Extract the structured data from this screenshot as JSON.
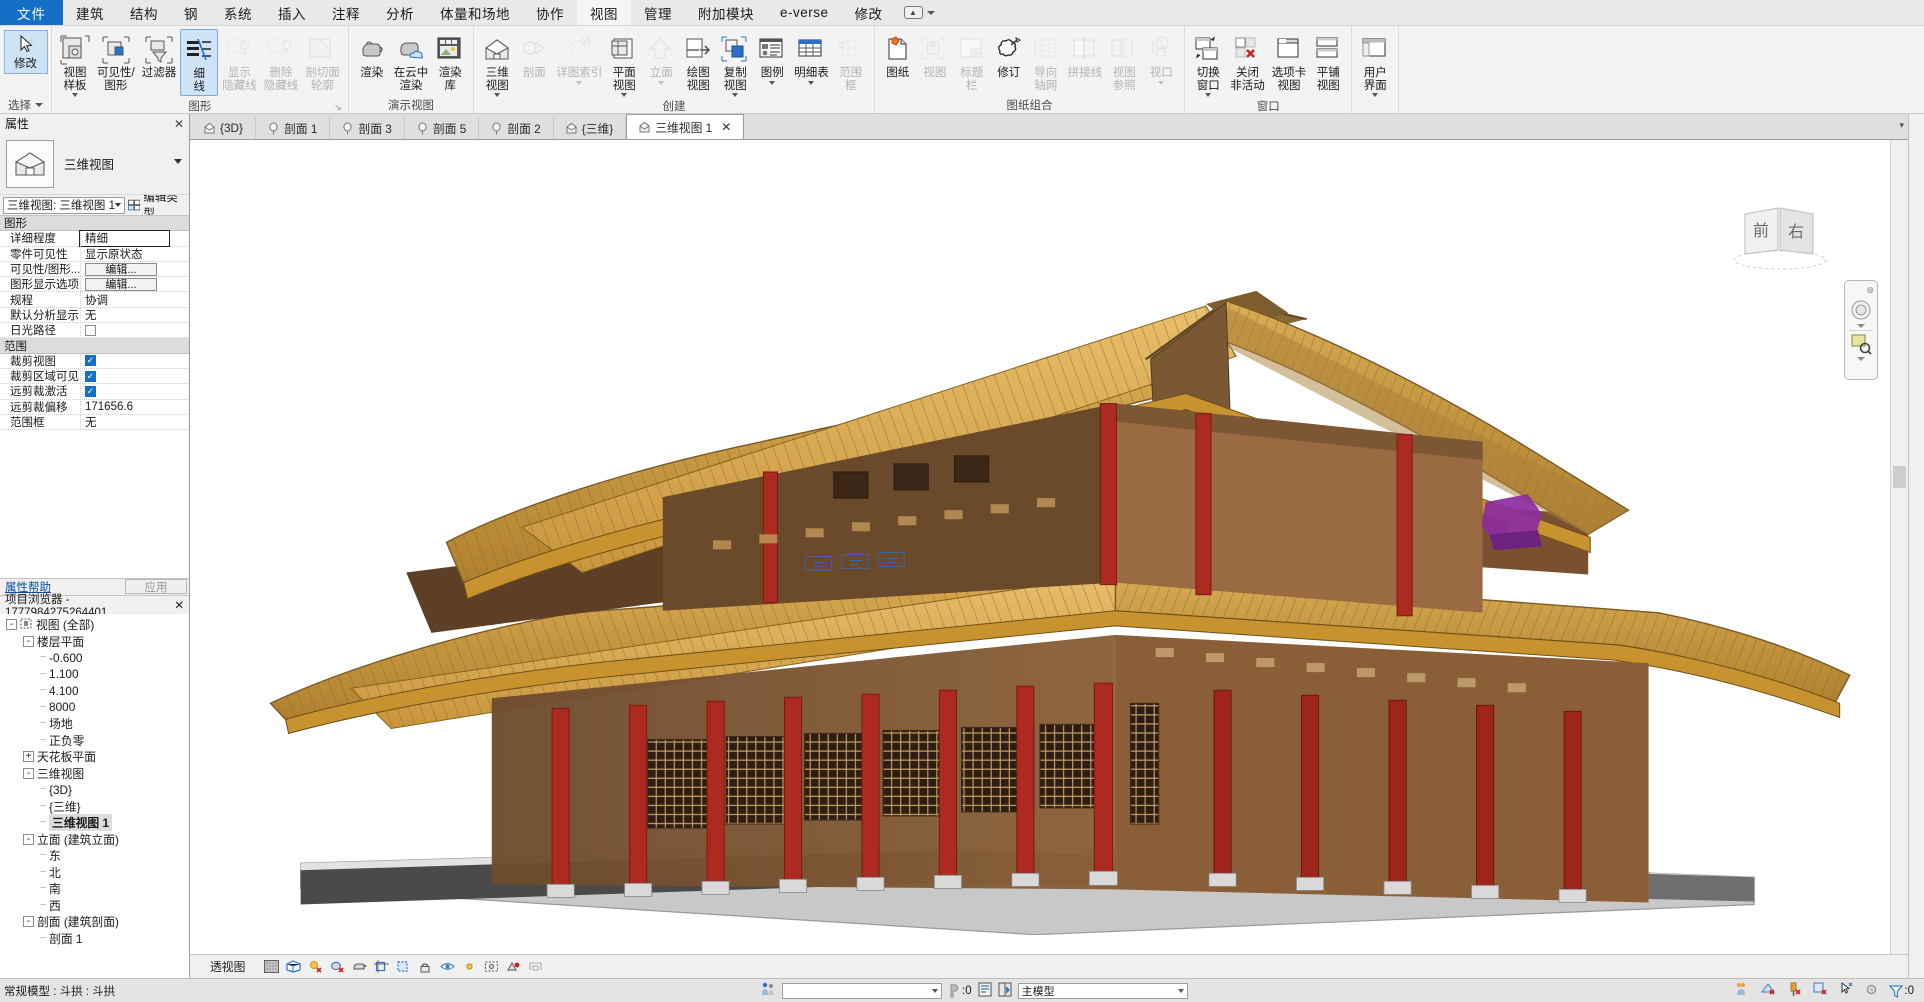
{
  "menubar": {
    "file_label": "文件",
    "items": [
      "建筑",
      "结构",
      "钢",
      "系统",
      "插入",
      "注释",
      "分析",
      "体量和场地",
      "协作",
      "视图",
      "管理",
      "附加模块",
      "e-verse",
      "修改"
    ],
    "active": "视图"
  },
  "ribbon": {
    "select_group": {
      "title": "选择",
      "button_label": "修改",
      "icon": "cursor-arrow-icon"
    },
    "groups": [
      {
        "title": "图形",
        "has_launcher": true,
        "buttons": [
          {
            "label": "视图\n样板",
            "icon": "view-template-icon",
            "state": "normal",
            "dropdown": true
          },
          {
            "label": "可见性/\n图形",
            "icon": "visibility-graphics-icon",
            "state": "normal",
            "dropdown": false
          },
          {
            "label": "过滤器",
            "icon": "filter-icon",
            "state": "normal",
            "dropdown": false
          },
          {
            "label": "细\n线",
            "icon": "thin-lines-icon",
            "state": "selected",
            "dropdown": false
          },
          {
            "label": "显示\n隐藏线",
            "icon": "show-hidden-lines-icon",
            "state": "disabled",
            "dropdown": false
          },
          {
            "label": "删除\n隐藏线",
            "icon": "remove-hidden-lines-icon",
            "state": "disabled",
            "dropdown": false
          },
          {
            "label": "剖切面\n轮廓",
            "icon": "cut-profile-icon",
            "state": "disabled",
            "dropdown": false
          }
        ]
      },
      {
        "title": "演示视图",
        "has_launcher": false,
        "buttons": [
          {
            "label": "渲染",
            "icon": "render-teapot-icon",
            "state": "normal",
            "dropdown": false
          },
          {
            "label": "在云中\n渲染",
            "icon": "render-cloud-icon",
            "state": "normal",
            "dropdown": false
          },
          {
            "label": "渲染\n库",
            "icon": "render-gallery-icon",
            "state": "normal",
            "dropdown": false
          }
        ]
      },
      {
        "title": "创建",
        "has_launcher": false,
        "buttons": [
          {
            "label": "三维\n视图",
            "icon": "3d-view-house-icon",
            "state": "normal",
            "dropdown": true
          },
          {
            "label": "剖面",
            "icon": "section-icon",
            "state": "disabled",
            "dropdown": false
          },
          {
            "label": "详图索引",
            "icon": "callout-icon",
            "state": "disabled",
            "dropdown": true
          },
          {
            "label": "平面\n视图",
            "icon": "plan-view-icon",
            "state": "normal",
            "dropdown": true
          },
          {
            "label": "立面",
            "icon": "elevation-icon",
            "state": "disabled",
            "dropdown": true
          },
          {
            "label": "绘图\n视图",
            "icon": "drafting-view-icon",
            "state": "normal",
            "dropdown": false
          },
          {
            "label": "复制\n视图",
            "icon": "duplicate-view-icon",
            "state": "normal",
            "dropdown": true
          },
          {
            "label": "图例",
            "icon": "legend-icon",
            "state": "normal",
            "dropdown": true
          },
          {
            "label": "明细表",
            "icon": "schedule-icon",
            "state": "normal",
            "dropdown": true
          },
          {
            "label": "范围\n框",
            "icon": "scope-box-icon",
            "state": "disabled",
            "dropdown": false
          }
        ]
      },
      {
        "title": "图纸组合",
        "has_launcher": false,
        "buttons": [
          {
            "label": "图纸",
            "icon": "sheet-icon",
            "state": "normal",
            "dropdown": false
          },
          {
            "label": "视图",
            "icon": "place-view-icon",
            "state": "disabled",
            "dropdown": false
          },
          {
            "label": "标题\n栏",
            "icon": "titleblock-icon",
            "state": "disabled",
            "dropdown": false
          },
          {
            "label": "修订",
            "icon": "revision-icon",
            "state": "normal",
            "dropdown": false
          },
          {
            "label": "导向\n轴网",
            "icon": "guide-grid-icon",
            "state": "disabled",
            "dropdown": false
          },
          {
            "label": "拼接线",
            "icon": "matchline-icon",
            "state": "disabled",
            "dropdown": false
          },
          {
            "label": "视图\n参照",
            "icon": "view-reference-icon",
            "state": "disabled",
            "dropdown": false
          },
          {
            "label": "视口",
            "icon": "viewport-icon",
            "state": "disabled",
            "dropdown": true
          }
        ]
      },
      {
        "title": "窗口",
        "has_launcher": false,
        "buttons": [
          {
            "label": "切换\n窗口",
            "icon": "switch-window-icon",
            "state": "normal",
            "dropdown": true
          },
          {
            "label": "关闭\n非活动",
            "icon": "close-inactive-icon",
            "state": "normal",
            "dropdown": false
          },
          {
            "label": "选项卡\n视图",
            "icon": "tab-views-icon",
            "state": "normal",
            "dropdown": false
          },
          {
            "label": "平铺\n视图",
            "icon": "tile-views-icon",
            "state": "normal",
            "dropdown": false
          }
        ]
      },
      {
        "title": "",
        "has_launcher": false,
        "buttons": [
          {
            "label": "用户\n界面",
            "icon": "user-interface-icon",
            "state": "normal",
            "dropdown": true
          }
        ]
      }
    ]
  },
  "properties": {
    "panel_title": "属性",
    "close_label": "✕",
    "type_name": "三维视图",
    "type_icon": "3d-view-house-icon",
    "selector_value": "三维视图: 三维视图 1",
    "edit_type_label": "编辑类型",
    "rows": [
      {
        "kind": "category",
        "name": "图形"
      },
      {
        "kind": "text",
        "name": "详细程度",
        "value": "精细",
        "editing": true
      },
      {
        "kind": "text",
        "name": "零件可见性",
        "value": "显示原状态"
      },
      {
        "kind": "button",
        "name": "可见性/图形...",
        "value": "编辑..."
      },
      {
        "kind": "button",
        "name": "图形显示选项",
        "value": "编辑..."
      },
      {
        "kind": "text",
        "name": "规程",
        "value": "协调"
      },
      {
        "kind": "text",
        "name": "默认分析显示...",
        "value": "无"
      },
      {
        "kind": "checkbox",
        "name": "日光路径",
        "checked": false
      },
      {
        "kind": "category",
        "name": "范围"
      },
      {
        "kind": "checkbox",
        "name": "裁剪视图",
        "checked": true
      },
      {
        "kind": "checkbox",
        "name": "裁剪区域可见",
        "checked": true
      },
      {
        "kind": "checkbox",
        "name": "远剪裁激活",
        "checked": true
      },
      {
        "kind": "text",
        "name": "远剪裁偏移",
        "value": "171656.6"
      },
      {
        "kind": "text",
        "name": "范围框",
        "value": "无"
      }
    ],
    "help_label": "属性帮助",
    "apply_label": "应用"
  },
  "browser": {
    "title": "项目浏览器 - 1777984275264401...",
    "close_label": "✕",
    "nodes": [
      {
        "depth": 0,
        "label": "视图 (全部)",
        "toggle": "-",
        "icon": "views-root-icon",
        "selected": false
      },
      {
        "depth": 1,
        "label": "楼层平面",
        "toggle": "-",
        "selected": false
      },
      {
        "depth": 2,
        "label": "-0.600",
        "toggle": "",
        "selected": false
      },
      {
        "depth": 2,
        "label": "1.100",
        "toggle": "",
        "selected": false
      },
      {
        "depth": 2,
        "label": "4.100",
        "toggle": "",
        "selected": false
      },
      {
        "depth": 2,
        "label": "8000",
        "toggle": "",
        "selected": false
      },
      {
        "depth": 2,
        "label": "场地",
        "toggle": "",
        "selected": false
      },
      {
        "depth": 2,
        "label": "正负零",
        "toggle": "",
        "selected": false
      },
      {
        "depth": 1,
        "label": "天花板平面",
        "toggle": "+",
        "selected": false
      },
      {
        "depth": 1,
        "label": "三维视图",
        "toggle": "-",
        "selected": false
      },
      {
        "depth": 2,
        "label": "{3D}",
        "toggle": "",
        "selected": false
      },
      {
        "depth": 2,
        "label": "{三维}",
        "toggle": "",
        "selected": false
      },
      {
        "depth": 2,
        "label": "三维视图 1",
        "toggle": "",
        "selected": true
      },
      {
        "depth": 1,
        "label": "立面 (建筑立面)",
        "toggle": "-",
        "selected": false
      },
      {
        "depth": 2,
        "label": "东",
        "toggle": "",
        "selected": false
      },
      {
        "depth": 2,
        "label": "北",
        "toggle": "",
        "selected": false
      },
      {
        "depth": 2,
        "label": "南",
        "toggle": "",
        "selected": false
      },
      {
        "depth": 2,
        "label": "西",
        "toggle": "",
        "selected": false
      },
      {
        "depth": 1,
        "label": "剖面 (建筑剖面)",
        "toggle": "-",
        "selected": false
      },
      {
        "depth": 2,
        "label": "剖面 1",
        "toggle": "",
        "selected": false
      }
    ]
  },
  "view_tabs": {
    "tabs": [
      {
        "label": "{3D}",
        "icon": "3d-view-icon",
        "active": false,
        "closable": false
      },
      {
        "label": "剖面 1",
        "icon": "section-view-icon",
        "active": false,
        "closable": false
      },
      {
        "label": "剖面 3",
        "icon": "section-view-icon",
        "active": false,
        "closable": false
      },
      {
        "label": "剖面 5",
        "icon": "section-view-icon",
        "active": false,
        "closable": false
      },
      {
        "label": "剖面 2",
        "icon": "section-view-icon",
        "active": false,
        "closable": false
      },
      {
        "label": "{三维}",
        "icon": "3d-view-icon",
        "active": false,
        "closable": false
      },
      {
        "label": "三维视图 1",
        "icon": "3d-view-icon",
        "active": true,
        "closable": true
      }
    ],
    "close_glyph": "✕"
  },
  "viewbar": {
    "scale_label": "透视图",
    "icons": [
      "detail-level-icon",
      "visual-style-icon",
      "sun-path-icon",
      "shadows-off-icon",
      "render-dialog-icon",
      "crop-view-icon",
      "crop-region-icon",
      "unlock-3d-icon",
      "temporary-hide-icon",
      "reveal-hidden-icon",
      "analytical-model-icon",
      "highlight-displacement-icon",
      "constraints-icon"
    ]
  },
  "viewcube": {
    "face_front": "前",
    "face_right": "右"
  },
  "statusbar": {
    "left_text": "常规模型 : 斗拱 : 斗拱",
    "filter_combo_value": "",
    "selection_count": ":0",
    "workset_value": "主模型",
    "exclude_count": ":0",
    "right_icons": [
      "select-links-icon",
      "select-underlay-icon",
      "select-pinned-icon",
      "select-by-face-icon",
      "drag-elements-icon",
      "settings-icon",
      "filter-icon"
    ]
  },
  "colors": {
    "accent": "#1470c4",
    "ribbon_bg": "#f3f3f3",
    "panel_bg": "#f0f0f0",
    "selected_tree": "#dcdcdc",
    "roof_gold": "#d7a646",
    "roof_dark": "#6b4a22",
    "column_red": "#b02b22",
    "wall_brown": "#9a6b43",
    "base_gray": "#b9b9b9"
  }
}
